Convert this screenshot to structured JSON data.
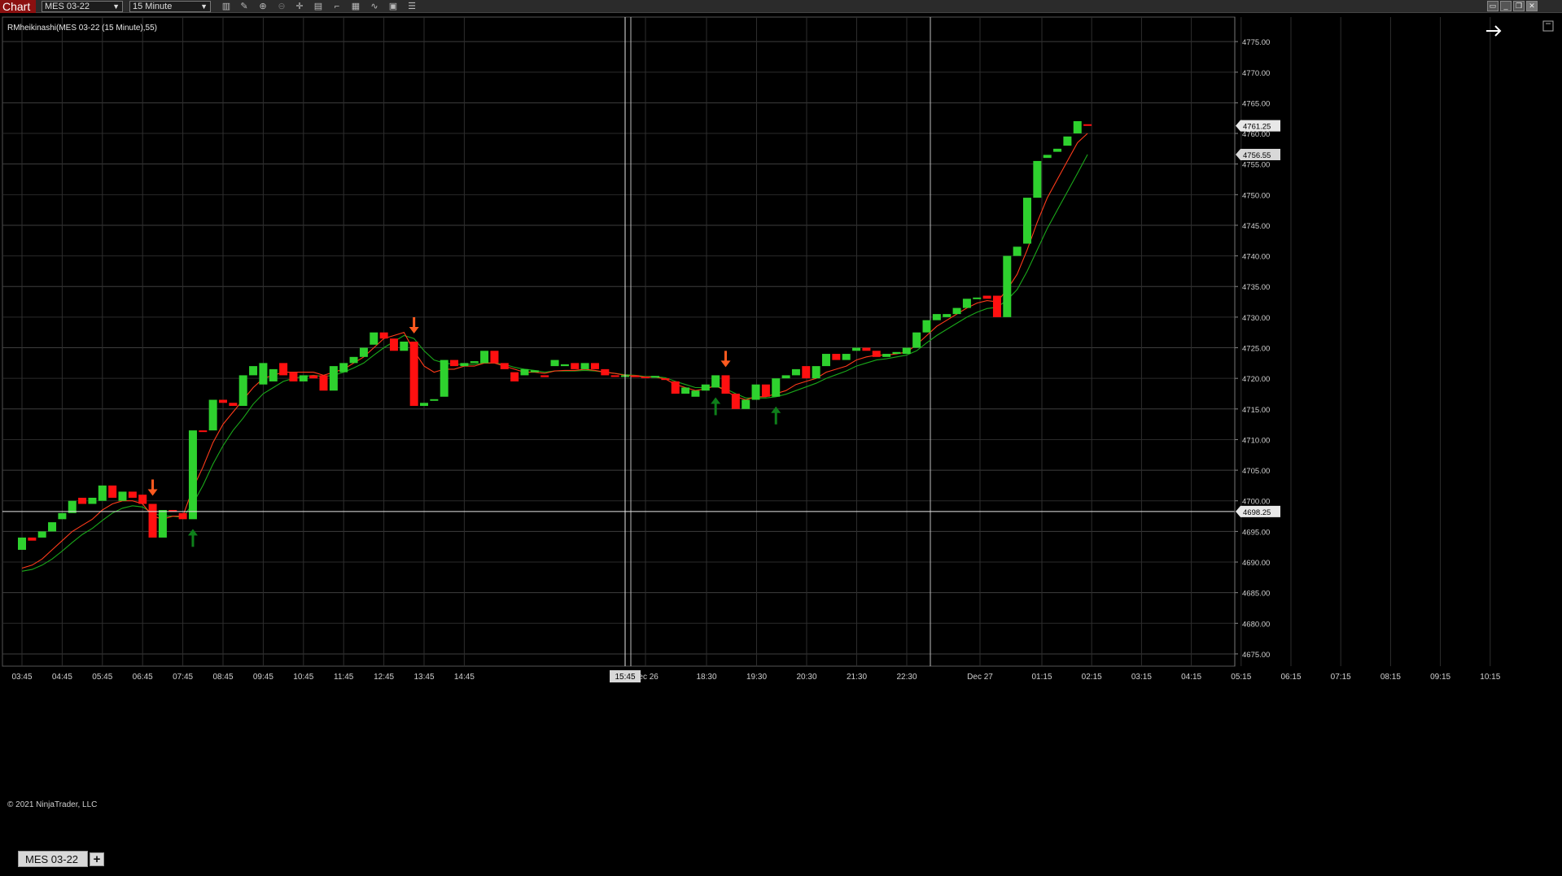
{
  "toolbar": {
    "tab_label": "Chart",
    "instrument": "MES 03-22",
    "interval": "15 Minute",
    "icons": [
      "bar-type-icon",
      "draw-pencil-icon",
      "zoom-in-icon",
      "zoom-out-icon",
      "crosshair-icon",
      "data-box-icon",
      "drawing-tools-icon",
      "indicators-icon",
      "strategies-icon",
      "templates-icon",
      "properties-icon"
    ]
  },
  "window_buttons": [
    "chart-tabs-icon",
    "minimize-icon",
    "restore-icon",
    "close-icon"
  ],
  "chart": {
    "indicator_label": "RMheikinashi(MES 03-22 (15 Minute),55)",
    "copyright": "© 2021 NinjaTrader, LLC",
    "crosshair_time": "15:45",
    "last_price": "4761.25",
    "ma_price": "4756.55",
    "crosshair_price": "4698.25",
    "up_color": "#2ed12e",
    "down_color": "#ff1010",
    "fast_ma_color": "#ff3b1a",
    "slow_ma_color": "#1aa81a",
    "arrow_down_color": "#ff5a1f",
    "arrow_up_color": "#0e7f1a"
  },
  "chart_data": {
    "type": "candlestick",
    "title": "RMheikinashi(MES 03-22 (15 Minute),55)",
    "ylim": [
      4673,
      4779
    ],
    "yticks": [
      "4775.00",
      "4770.00",
      "4765.00",
      "4760.00",
      "4755.00",
      "4750.00",
      "4745.00",
      "4740.00",
      "4735.00",
      "4730.00",
      "4725.00",
      "4720.00",
      "4715.00",
      "4710.00",
      "4705.00",
      "4700.00",
      "4695.00",
      "4690.00",
      "4685.00",
      "4680.00",
      "4675.00"
    ],
    "xticks": [
      "03:45",
      "04:45",
      "05:45",
      "06:45",
      "07:45",
      "08:45",
      "09:45",
      "10:45",
      "11:45",
      "12:45",
      "13:45",
      "14:45",
      "15:45",
      "Dec 26",
      "18:30",
      "19:30",
      "20:30",
      "21:30",
      "22:30",
      "Dec 27",
      "01:15",
      "02:15",
      "03:15",
      "04:15",
      "05:15",
      "06:15",
      "07:15",
      "08:15",
      "09:15",
      "10:15"
    ],
    "candles": [
      {
        "o": 4692.0,
        "c": 4694.0
      },
      {
        "o": 4694.0,
        "c": 4693.5
      },
      {
        "o": 4694.0,
        "c": 4695.0
      },
      {
        "o": 4695.0,
        "c": 4696.5
      },
      {
        "o": 4697.0,
        "c": 4698.0
      },
      {
        "o": 4698.0,
        "c": 4700.0
      },
      {
        "o": 4700.5,
        "c": 4699.5
      },
      {
        "o": 4699.5,
        "c": 4700.5
      },
      {
        "o": 4700.0,
        "c": 4702.5
      },
      {
        "o": 4702.5,
        "c": 4700.5
      },
      {
        "o": 4700.0,
        "c": 4701.5
      },
      {
        "o": 4701.5,
        "c": 4700.5
      },
      {
        "o": 4701.0,
        "c": 4699.5
      },
      {
        "o": 4699.5,
        "c": 4694.0
      },
      {
        "o": 4694.0,
        "c": 4698.5
      },
      {
        "o": 4698.5,
        "c": 4698.2
      },
      {
        "o": 4698.0,
        "c": 4697.0
      },
      {
        "o": 4697.0,
        "c": 4711.5
      },
      {
        "o": 4711.5,
        "c": 4711.3
      },
      {
        "o": 4711.5,
        "c": 4716.5
      },
      {
        "o": 4716.5,
        "c": 4716.0
      },
      {
        "o": 4716.0,
        "c": 4715.5
      },
      {
        "o": 4715.5,
        "c": 4720.5
      },
      {
        "o": 4720.5,
        "c": 4722.0
      },
      {
        "o": 4719.0,
        "c": 4722.5
      },
      {
        "o": 4719.5,
        "c": 4721.5
      },
      {
        "o": 4722.5,
        "c": 4720.5
      },
      {
        "o": 4721.0,
        "c": 4719.5
      },
      {
        "o": 4719.5,
        "c": 4720.5
      },
      {
        "o": 4720.5,
        "c": 4720.0
      },
      {
        "o": 4720.5,
        "c": 4718.0
      },
      {
        "o": 4718.0,
        "c": 4722.0
      },
      {
        "o": 4721.0,
        "c": 4722.5
      },
      {
        "o": 4722.5,
        "c": 4723.5
      },
      {
        "o": 4723.5,
        "c": 4725.0
      },
      {
        "o": 4725.5,
        "c": 4727.5
      },
      {
        "o": 4727.5,
        "c": 4726.5
      },
      {
        "o": 4726.5,
        "c": 4724.5
      },
      {
        "o": 4724.5,
        "c": 4726.0
      },
      {
        "o": 4726.0,
        "c": 4715.5
      },
      {
        "o": 4715.5,
        "c": 4716.0
      },
      {
        "o": 4716.5,
        "c": 4716.6
      },
      {
        "o": 4717.0,
        "c": 4723.0
      },
      {
        "o": 4723.0,
        "c": 4722.0
      },
      {
        "o": 4722.0,
        "c": 4722.5
      },
      {
        "o": 4722.5,
        "c": 4722.8
      },
      {
        "o": 4722.5,
        "c": 4724.5
      },
      {
        "o": 4724.5,
        "c": 4722.5
      },
      {
        "o": 4722.5,
        "c": 4721.5
      },
      {
        "o": 4721.0,
        "c": 4719.5
      },
      {
        "o": 4720.5,
        "c": 4721.5
      },
      {
        "o": 4721.0,
        "c": 4721.3
      },
      {
        "o": 4720.5,
        "c": 4720.2
      },
      {
        "o": 4722.0,
        "c": 4723.0
      },
      {
        "o": 4722.0,
        "c": 4722.3
      },
      {
        "o": 4722.5,
        "c": 4721.5
      },
      {
        "o": 4721.5,
        "c": 4722.5
      },
      {
        "o": 4722.5,
        "c": 4721.5
      },
      {
        "o": 4721.5,
        "c": 4720.5
      },
      {
        "o": 4720.5,
        "c": 4720.3
      },
      {
        "o": 4720.3,
        "c": 4720.5
      },
      {
        "o": 4720.5,
        "c": 4720.2
      },
      {
        "o": 4720.3,
        "c": 4720.1
      },
      {
        "o": 4720.1,
        "c": 4720.4
      },
      {
        "o": 4720.0,
        "c": 4719.8
      },
      {
        "o": 4719.5,
        "c": 4717.5
      },
      {
        "o": 4717.5,
        "c": 4718.5
      },
      {
        "o": 4717.0,
        "c": 4718.0
      },
      {
        "o": 4718.0,
        "c": 4719.0
      },
      {
        "o": 4718.5,
        "c": 4720.5
      },
      {
        "o": 4720.5,
        "c": 4717.5
      },
      {
        "o": 4717.5,
        "c": 4715.0
      },
      {
        "o": 4715.0,
        "c": 4716.5
      },
      {
        "o": 4716.5,
        "c": 4719.0
      },
      {
        "o": 4719.0,
        "c": 4717.0
      },
      {
        "o": 4717.0,
        "c": 4720.0
      },
      {
        "o": 4720.0,
        "c": 4720.5
      },
      {
        "o": 4720.5,
        "c": 4721.5
      },
      {
        "o": 4722.0,
        "c": 4720.0
      },
      {
        "o": 4720.0,
        "c": 4722.0
      },
      {
        "o": 4722.0,
        "c": 4724.0
      },
      {
        "o": 4724.0,
        "c": 4723.0
      },
      {
        "o": 4723.0,
        "c": 4724.0
      },
      {
        "o": 4724.5,
        "c": 4725.0
      },
      {
        "o": 4725.0,
        "c": 4724.5
      },
      {
        "o": 4724.5,
        "c": 4723.5
      },
      {
        "o": 4723.5,
        "c": 4724.0
      },
      {
        "o": 4724.0,
        "c": 4724.3
      },
      {
        "o": 4724.0,
        "c": 4725.0
      },
      {
        "o": 4725.0,
        "c": 4727.5
      },
      {
        "o": 4727.5,
        "c": 4729.5
      },
      {
        "o": 4729.5,
        "c": 4730.5
      },
      {
        "o": 4730.0,
        "c": 4730.5
      },
      {
        "o": 4730.5,
        "c": 4731.5
      },
      {
        "o": 4731.5,
        "c": 4733.0
      },
      {
        "o": 4733.0,
        "c": 4733.2
      },
      {
        "o": 4733.5,
        "c": 4733.0
      },
      {
        "o": 4733.5,
        "c": 4730.0
      },
      {
        "o": 4730.0,
        "c": 4740.0
      },
      {
        "o": 4740.0,
        "c": 4741.5
      },
      {
        "o": 4742.0,
        "c": 4749.5
      },
      {
        "o": 4749.5,
        "c": 4755.5
      },
      {
        "o": 4756.0,
        "c": 4756.5
      },
      {
        "o": 4757.0,
        "c": 4757.5
      },
      {
        "o": 4758.0,
        "c": 4759.5
      },
      {
        "o": 4760.0,
        "c": 4762.0
      },
      {
        "o": 4761.5,
        "c": 4761.25
      }
    ],
    "fast_ma": [
      4689.0,
      4689.5,
      4690.5,
      4692.0,
      4693.5,
      4695.0,
      4696.0,
      4697.0,
      4698.5,
      4699.5,
      4700.0,
      4700.0,
      4699.5,
      4697.5,
      4697.0,
      4697.5,
      4697.5,
      4702.0,
      4705.5,
      4709.5,
      4712.5,
      4714.5,
      4716.5,
      4718.5,
      4720.0,
      4720.5,
      4721.0,
      4721.0,
      4721.0,
      4721.0,
      4720.5,
      4721.0,
      4721.5,
      4722.5,
      4723.5,
      4725.0,
      4726.5,
      4727.0,
      4727.5,
      4724.5,
      4722.0,
      4721.0,
      4721.5,
      4721.5,
      4722.0,
      4722.0,
      4722.5,
      4722.5,
      4722.0,
      4721.5,
      4721.0,
      4721.0,
      4720.8,
      4721.2,
      4721.3,
      4721.3,
      4721.5,
      4721.3,
      4721.0,
      4720.8,
      4720.5,
      4720.4,
      4720.2,
      4720.2,
      4719.9,
      4719.0,
      4718.5,
      4718.0,
      4718.3,
      4718.8,
      4718.0,
      4717.0,
      4716.5,
      4717.0,
      4717.0,
      4717.5,
      4718.0,
      4719.0,
      4719.5,
      4720.0,
      4721.0,
      4721.5,
      4722.0,
      4723.0,
      4723.5,
      4723.8,
      4723.8,
      4724.0,
      4724.3,
      4725.5,
      4727.0,
      4728.5,
      4729.5,
      4730.5,
      4731.5,
      4732.3,
      4732.7,
      4732.5,
      4734.5,
      4737.0,
      4741.0,
      4745.5,
      4749.5,
      4752.5,
      4755.5,
      4758.5,
      4760.0
    ],
    "slow_ma": [
      4688.5,
      4688.8,
      4689.5,
      4690.5,
      4691.8,
      4693.2,
      4694.5,
      4695.5,
      4696.8,
      4698.0,
      4698.8,
      4699.2,
      4699.0,
      4698.0,
      4697.5,
      4697.5,
      4697.3,
      4699.5,
      4702.5,
      4706.0,
      4709.0,
      4711.5,
      4713.5,
      4715.8,
      4717.5,
      4718.5,
      4719.5,
      4720.0,
      4720.3,
      4720.5,
      4720.3,
      4720.5,
      4721.0,
      4721.7,
      4722.5,
      4723.8,
      4725.0,
      4726.0,
      4727.0,
      4726.5,
      4724.5,
      4723.0,
      4722.5,
      4722.3,
      4722.3,
      4722.3,
      4722.5,
      4722.5,
      4722.3,
      4721.8,
      4721.5,
      4721.3,
      4721.0,
      4721.2,
      4721.2,
      4721.2,
      4721.3,
      4721.2,
      4721.0,
      4720.8,
      4720.6,
      4720.5,
      4720.3,
      4720.3,
      4720.1,
      4719.5,
      4719.0,
      4718.5,
      4718.5,
      4718.7,
      4718.3,
      4717.5,
      4716.8,
      4716.8,
      4716.8,
      4717.0,
      4717.4,
      4718.0,
      4718.6,
      4719.2,
      4720.0,
      4720.6,
      4721.2,
      4722.0,
      4722.5,
      4723.0,
      4723.2,
      4723.5,
      4723.8,
      4724.5,
      4725.8,
      4727.0,
      4728.0,
      4729.0,
      4730.0,
      4730.8,
      4731.4,
      4731.6,
      4732.8,
      4734.5,
      4737.5,
      4741.0,
      4744.5,
      4747.5,
      4750.5,
      4753.5,
      4756.55
    ],
    "signals": [
      {
        "bar": 13,
        "dir": "down"
      },
      {
        "bar": 17,
        "dir": "up"
      },
      {
        "bar": 39,
        "dir": "down"
      },
      {
        "bar": 69,
        "dir": "up"
      },
      {
        "bar": 70,
        "dir": "down"
      },
      {
        "bar": 75,
        "dir": "up"
      }
    ],
    "crosshair": {
      "bar": 42,
      "price": 4698.25
    },
    "session_breaks": [
      41,
      60
    ]
  },
  "tabs": {
    "instrument_tab": "MES 03-22",
    "add_tab": "+"
  }
}
